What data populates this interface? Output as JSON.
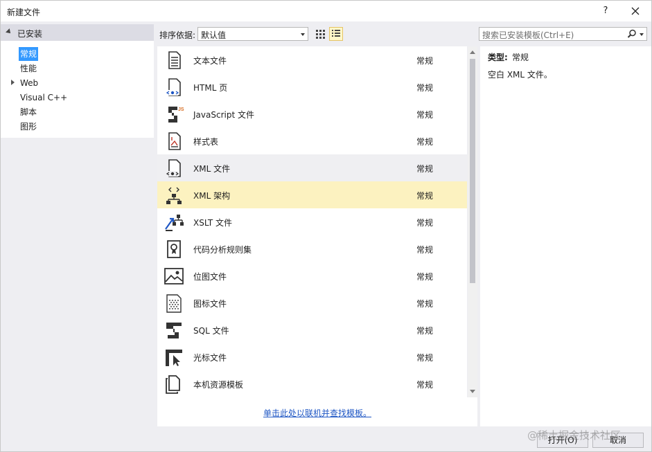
{
  "window": {
    "title": "新建文件",
    "help_label": "?"
  },
  "left_panel": {
    "header": "已安装",
    "items": [
      {
        "label": "常规",
        "selected": true,
        "expandable": false
      },
      {
        "label": "性能",
        "selected": false,
        "expandable": false
      },
      {
        "label": "Web",
        "selected": false,
        "expandable": true
      },
      {
        "label": "Visual C++",
        "selected": false,
        "expandable": false
      },
      {
        "label": "脚本",
        "selected": false,
        "expandable": false
      },
      {
        "label": "图形",
        "selected": false,
        "expandable": false
      }
    ]
  },
  "toolbar": {
    "sort_label": "排序依据:",
    "sort_value": "默认值",
    "views": [
      {
        "name": "small-icons-view",
        "active": false
      },
      {
        "name": "list-view",
        "active": true
      }
    ]
  },
  "search": {
    "placeholder": "搜索已安装模板(Ctrl+E)"
  },
  "templates": [
    {
      "name": "文本文件",
      "category": "常规",
      "icon": "text-file-icon",
      "state": ""
    },
    {
      "name": "HTML 页",
      "category": "常规",
      "icon": "html-page-icon",
      "state": ""
    },
    {
      "name": "JavaScript 文件",
      "category": "常规",
      "icon": "javascript-file-icon",
      "state": ""
    },
    {
      "name": "样式表",
      "category": "常规",
      "icon": "stylesheet-icon",
      "state": ""
    },
    {
      "name": "XML 文件",
      "category": "常规",
      "icon": "xml-file-icon",
      "state": "hover"
    },
    {
      "name": "XML 架构",
      "category": "常规",
      "icon": "xml-schema-icon",
      "state": "selected"
    },
    {
      "name": "XSLT 文件",
      "category": "常规",
      "icon": "xslt-file-icon",
      "state": ""
    },
    {
      "name": "代码分析规则集",
      "category": "常规",
      "icon": "ruleset-icon",
      "state": ""
    },
    {
      "name": "位图文件",
      "category": "常规",
      "icon": "bitmap-file-icon",
      "state": ""
    },
    {
      "name": "图标文件",
      "category": "常规",
      "icon": "icon-file-icon",
      "state": ""
    },
    {
      "name": "SQL 文件",
      "category": "常规",
      "icon": "sql-file-icon",
      "state": ""
    },
    {
      "name": "光标文件",
      "category": "常规",
      "icon": "cursor-file-icon",
      "state": ""
    },
    {
      "name": "本机资源模板",
      "category": "常规",
      "icon": "native-resource-icon",
      "state": ""
    }
  ],
  "online_link": "单击此处以联机并查找模板。",
  "details": {
    "type_label": "类型:",
    "type_value": "常规",
    "description": "空白 XML 文件。"
  },
  "buttons": {
    "open": "打开(O)",
    "cancel": "取消"
  },
  "watermark": "@稀土掘金技术社区"
}
